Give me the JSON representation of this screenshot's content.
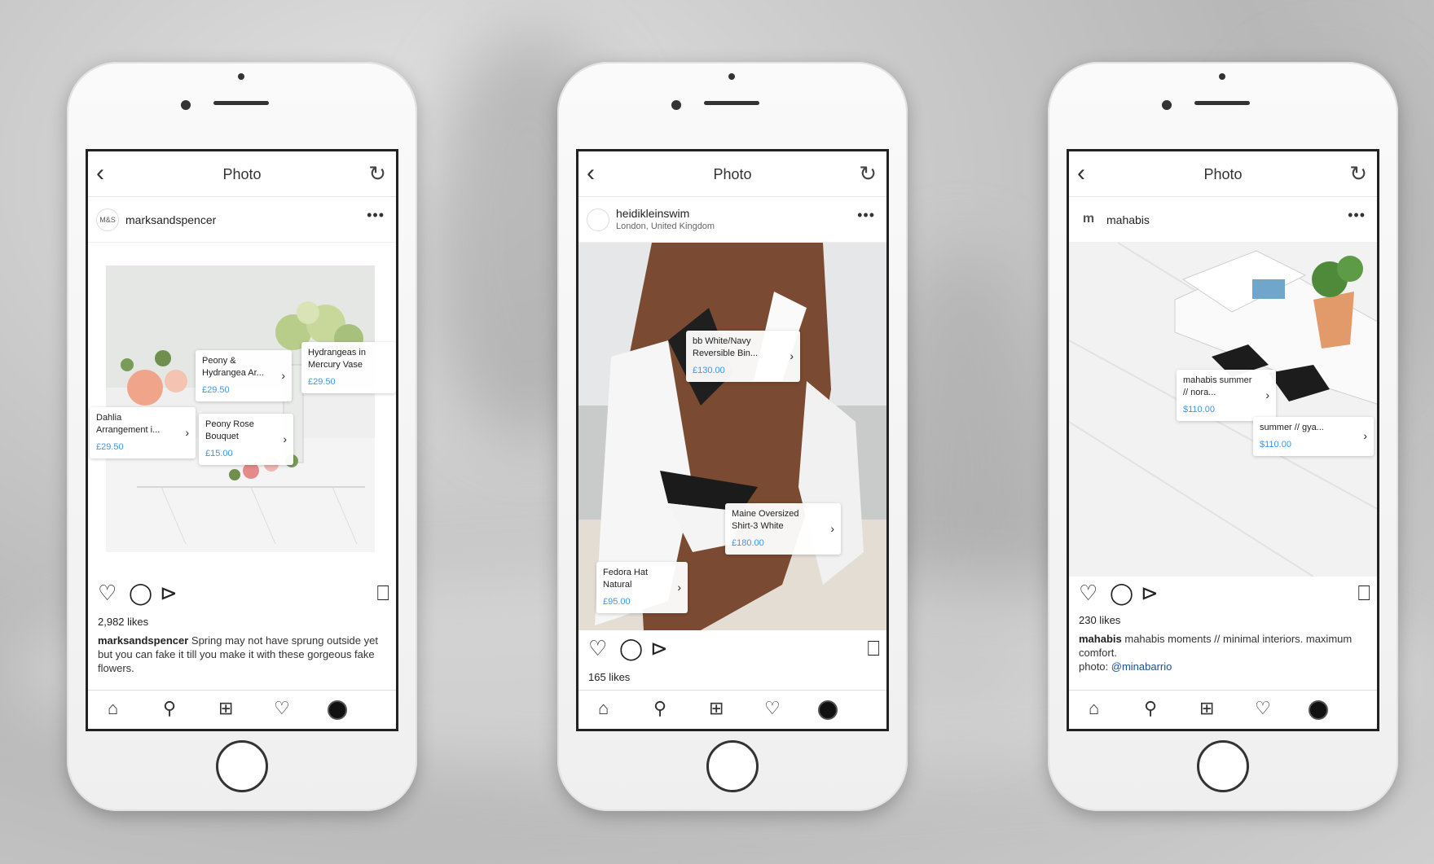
{
  "colors": {
    "price": "#3897f0",
    "link": "#1d4f91",
    "frame": "#222222"
  },
  "phones": [
    {
      "topbar": {
        "back_icon": "chevron-left-icon",
        "title": "Photo",
        "refresh_icon": "refresh-icon"
      },
      "user": {
        "name": "marksandspencer",
        "avatar_text": "M&S"
      },
      "tags": [
        {
          "name": "Peony & Hydrangea Ar...",
          "price": "£29.50"
        },
        {
          "name": "Hydrangeas in Mercury Vase",
          "price": "£29.50"
        },
        {
          "name": "Dahlia Arrangement i...",
          "price": "£29.50"
        },
        {
          "name": "Peony Rose Bouquet",
          "price": "£15.00"
        }
      ],
      "likes": "2,982 likes",
      "caption_user": "marksandspencer",
      "caption_text": " Spring may not have sprung outside yet but you can fake it till you make it with these gorgeous fake flowers."
    },
    {
      "topbar": {
        "back_icon": "chevron-left-icon",
        "title": "Photo",
        "refresh_icon": "refresh-icon"
      },
      "user": {
        "name": "heidikleinswim",
        "location": "London, United Kingdom"
      },
      "tags": [
        {
          "name": "bb White/Navy Reversible Bin...",
          "price": "£130.00"
        },
        {
          "name": "Maine Oversized Shirt-3 White",
          "price": "£180.00"
        },
        {
          "name": "Fedora Hat Natural",
          "price": "£95.00"
        }
      ],
      "likes": "165 likes"
    },
    {
      "topbar": {
        "back_icon": "chevron-left-icon",
        "title": "Photo",
        "refresh_icon": "refresh-icon"
      },
      "user": {
        "name": "mahabis"
      },
      "tags": [
        {
          "name": "mahabis summer // nora...",
          "price": "$110.00"
        },
        {
          "name": "summer // gya...",
          "price": "$110.00"
        }
      ],
      "likes": "230 likes",
      "caption_user": "mahabis",
      "caption_text": " mahabis moments // minimal interiors. maximum comfort.",
      "caption_photo_label": "photo: ",
      "caption_link": "@minabarrio"
    }
  ]
}
